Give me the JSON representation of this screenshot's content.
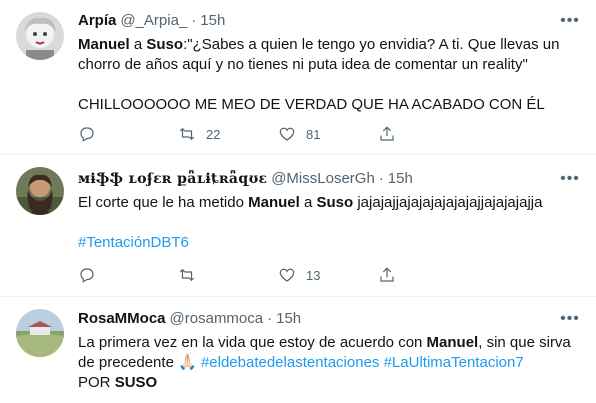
{
  "tweets": [
    {
      "name": "Arpía",
      "handle": "@_Arpia_",
      "time": "15h",
      "line1_bold1": "Manuel",
      "line1_mid": " a ",
      "line1_bold2": "Suso",
      "line1_rest": ":\"¿Sabes a quien le tengo yo envidia? A ti. Que llevas un chorro de años aquí y no tienes ni puta idea de comentar un reality\"",
      "line2": "CHILLOOOOOO ME MEO DE VERDAD QUE HA ACABADO CON ÉL",
      "retweets": "22",
      "likes": "81"
    },
    {
      "name": "ᴍɨֆֆ ʟօʄɛʀ քǟʟɨȶʀǟզʊɛ",
      "handle": "@MissLoserGh",
      "time": "15h",
      "pre": "El corte que le ha metido ",
      "bold1": "Manuel",
      "mid": " a ",
      "bold2": "Suso",
      "post": " jajajajjajajajajajajajjajajajajja",
      "hashtag": "#TentaciónDBT6",
      "retweets": "",
      "likes": "13"
    },
    {
      "name": "RosaMMoca",
      "handle": "@rosammoca",
      "time": "15h",
      "pre": "La primera vez en la vida que estoy de acuerdo con ",
      "bold1": "Manuel",
      "post1": ", sin que sirva de precedente ",
      "emoji": "🙏🏻",
      "hashtag1": "#eldebatedelastentaciones",
      "hashtag2": "#LaUltimaTentacion7",
      "line3_pre": "POR ",
      "line3_bold": "SUSO"
    }
  ],
  "icons": {
    "more": "more-icon",
    "reply": "reply-icon",
    "retweet": "retweet-icon",
    "like": "heart-icon",
    "share": "share-icon"
  },
  "colors": {
    "link": "#1d9bf0",
    "muted": "#536471",
    "text": "#0f1419",
    "divider": "#eff3f4"
  }
}
